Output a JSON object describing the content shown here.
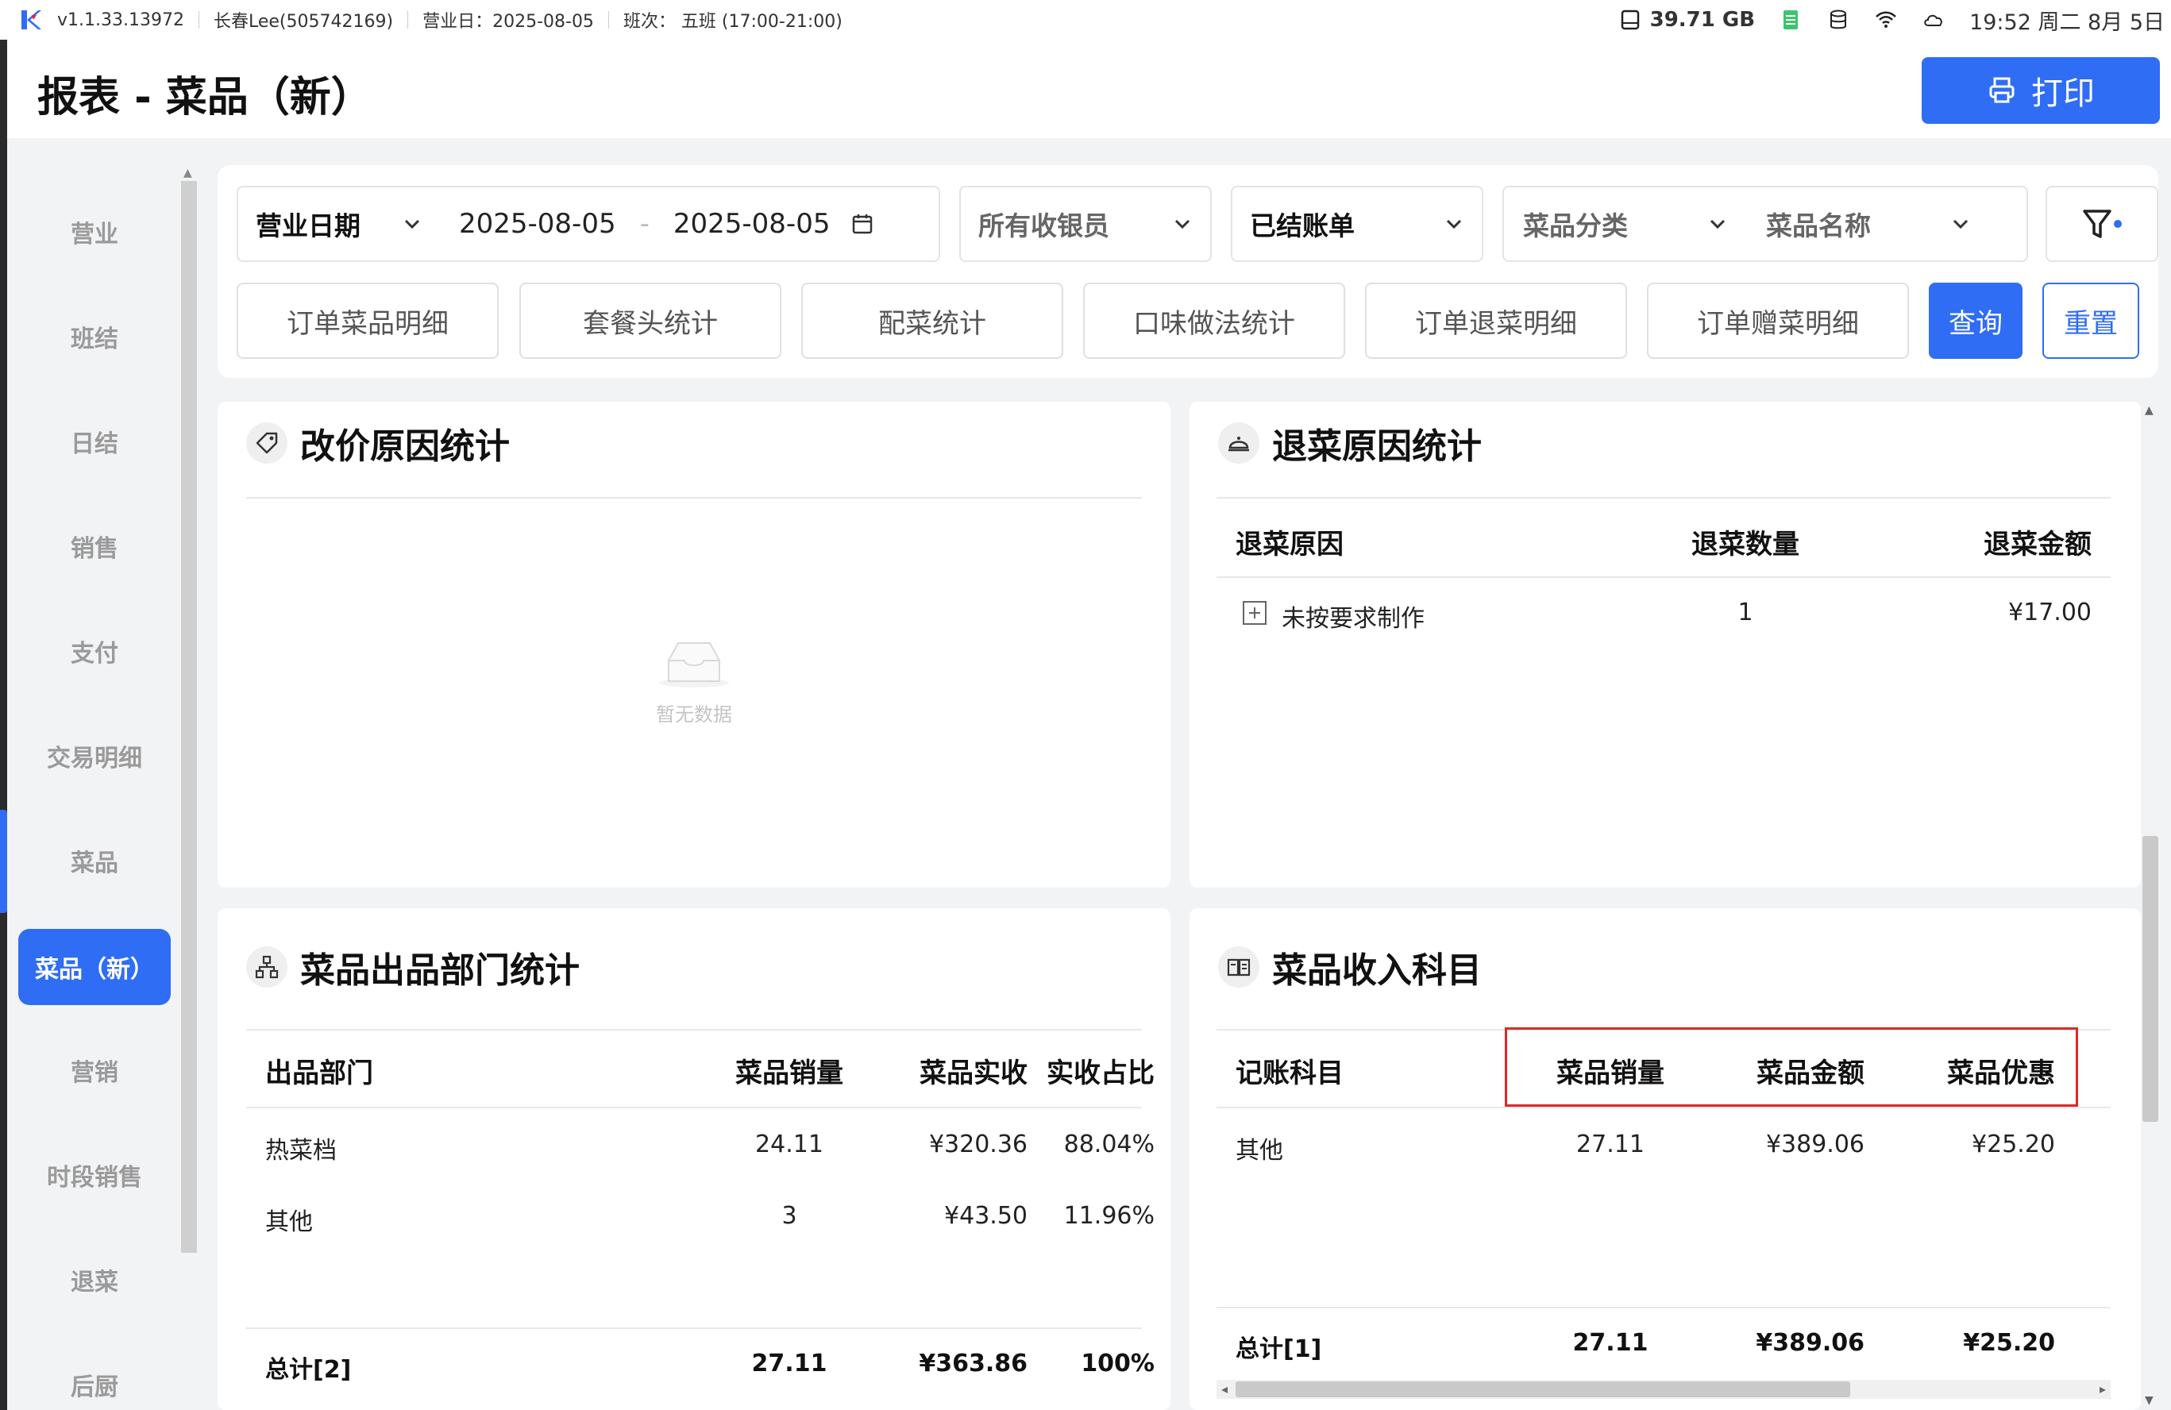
{
  "statusbar": {
    "version": "v1.1.33.13972",
    "user": "长春Lee(505742169)",
    "business_day": "营业日：2025-08-05",
    "shift": "班次：  五班 (17:00-21:00)",
    "disk": "39.71 GB",
    "clock": "19:52 周二 8月 5日"
  },
  "header": {
    "title": "报表 - 菜品（新）",
    "print_label": "打印"
  },
  "sidebar": {
    "items": [
      {
        "label": "营业",
        "active": false
      },
      {
        "label": "班结",
        "active": false
      },
      {
        "label": "日结",
        "active": false
      },
      {
        "label": "销售",
        "active": false
      },
      {
        "label": "支付",
        "active": false
      },
      {
        "label": "交易明细",
        "active": false
      },
      {
        "label": "菜品",
        "active": false
      },
      {
        "label": "菜品（新）",
        "active": true
      },
      {
        "label": "营销",
        "active": false
      },
      {
        "label": "时段销售",
        "active": false
      },
      {
        "label": "退菜",
        "active": false
      },
      {
        "label": "后厨",
        "active": false
      }
    ]
  },
  "filters": {
    "date_type": "营业日期",
    "start_date": "2025-08-05",
    "date_sep": "-",
    "end_date": "2025-08-05",
    "cashier": "所有收银员",
    "bill_status": "已结账单",
    "category": "菜品分类",
    "dish_name": "菜品名称",
    "buttons": [
      "订单菜品明细",
      "套餐头统计",
      "配菜统计",
      "口味做法统计",
      "订单退菜明细",
      "订单赠菜明细"
    ],
    "query_label": "查询",
    "reset_label": "重置"
  },
  "price_change": {
    "title": "改价原因统计",
    "empty_text": "暂无数据"
  },
  "return_reason": {
    "title": "退菜原因统计",
    "headers": [
      "退菜原因",
      "退菜数量",
      "退菜金额"
    ],
    "rows": [
      {
        "reason": "未按要求制作",
        "qty": "1",
        "amount": "¥17.00"
      }
    ]
  },
  "dept": {
    "title": "菜品出品部门统计",
    "headers": [
      "出品部门",
      "菜品销量",
      "菜品实收",
      "实收占比"
    ],
    "rows": [
      {
        "dept": "热菜档",
        "qty": "24.11",
        "received": "¥320.36",
        "ratio": "88.04%"
      },
      {
        "dept": "其他",
        "qty": "3",
        "received": "¥43.50",
        "ratio": "11.96%"
      }
    ],
    "total": {
      "label": "总计[2]",
      "qty": "27.11",
      "received": "¥363.86",
      "ratio": "100%"
    }
  },
  "income": {
    "title": "菜品收入科目",
    "headers": [
      "记账科目",
      "菜品销量",
      "菜品金额",
      "菜品优惠"
    ],
    "rows": [
      {
        "subject": "其他",
        "qty": "27.11",
        "amount": "¥389.06",
        "discount": "¥25.20"
      }
    ],
    "total": {
      "label": "总计[1]",
      "qty": "27.11",
      "amount": "¥389.06",
      "discount": "¥25.20"
    }
  },
  "colors": {
    "accent": "#2f6df5",
    "highlight": "#e0272b",
    "background": "#f2f3f5"
  },
  "icons": [
    "app-logo-icon",
    "disk-icon",
    "spreadsheet-icon",
    "database-icon",
    "wifi-icon",
    "cloud-icon",
    "printer-icon",
    "chevron-down-icon",
    "calendar-icon",
    "filter-icon",
    "tag-icon",
    "cloche-icon",
    "org-chart-icon",
    "book-icon",
    "empty-box-icon",
    "expand-plus-icon"
  ]
}
